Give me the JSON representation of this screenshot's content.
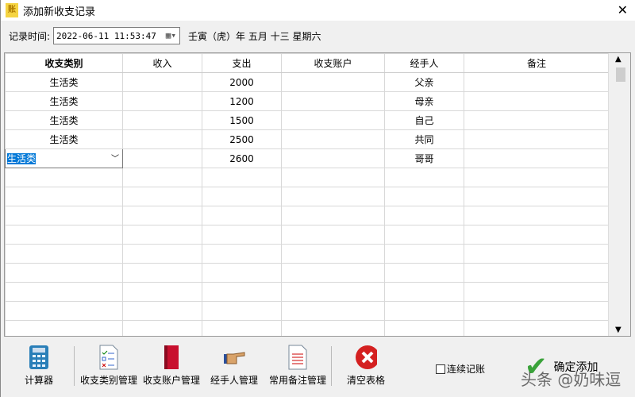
{
  "window": {
    "title": "添加新收支记录",
    "icon_text": "账"
  },
  "time": {
    "label": "记录时间:",
    "value": "2022-06-11 11:53:47",
    "lunar": "壬寅（虎）年 五月 十三 星期六"
  },
  "table": {
    "columns": [
      "收支类别",
      "收入",
      "支出",
      "收支账户",
      "经手人",
      "备注"
    ],
    "rows": [
      {
        "category": "生活类",
        "income": "",
        "expense": "2000",
        "account": "",
        "handler": "父亲",
        "note": ""
      },
      {
        "category": "生活类",
        "income": "",
        "expense": "1200",
        "account": "",
        "handler": "母亲",
        "note": ""
      },
      {
        "category": "生活类",
        "income": "",
        "expense": "1500",
        "account": "",
        "handler": "自己",
        "note": ""
      },
      {
        "category": "生活类",
        "income": "",
        "expense": "2500",
        "account": "",
        "handler": "共同",
        "note": ""
      },
      {
        "category": "生活类",
        "income": "",
        "expense": "2600",
        "account": "",
        "handler": "哥哥",
        "note": ""
      }
    ]
  },
  "toolbar": {
    "calculator": "计算器",
    "category_mgmt": "收支类别管理",
    "account_mgmt": "收支账户管理",
    "handler_mgmt": "经手人管理",
    "note_mgmt": "常用备注管理",
    "clear": "清空表格",
    "continuous": "连续记账",
    "confirm": "确定添加"
  },
  "watermark": "头条 @奶味逗"
}
